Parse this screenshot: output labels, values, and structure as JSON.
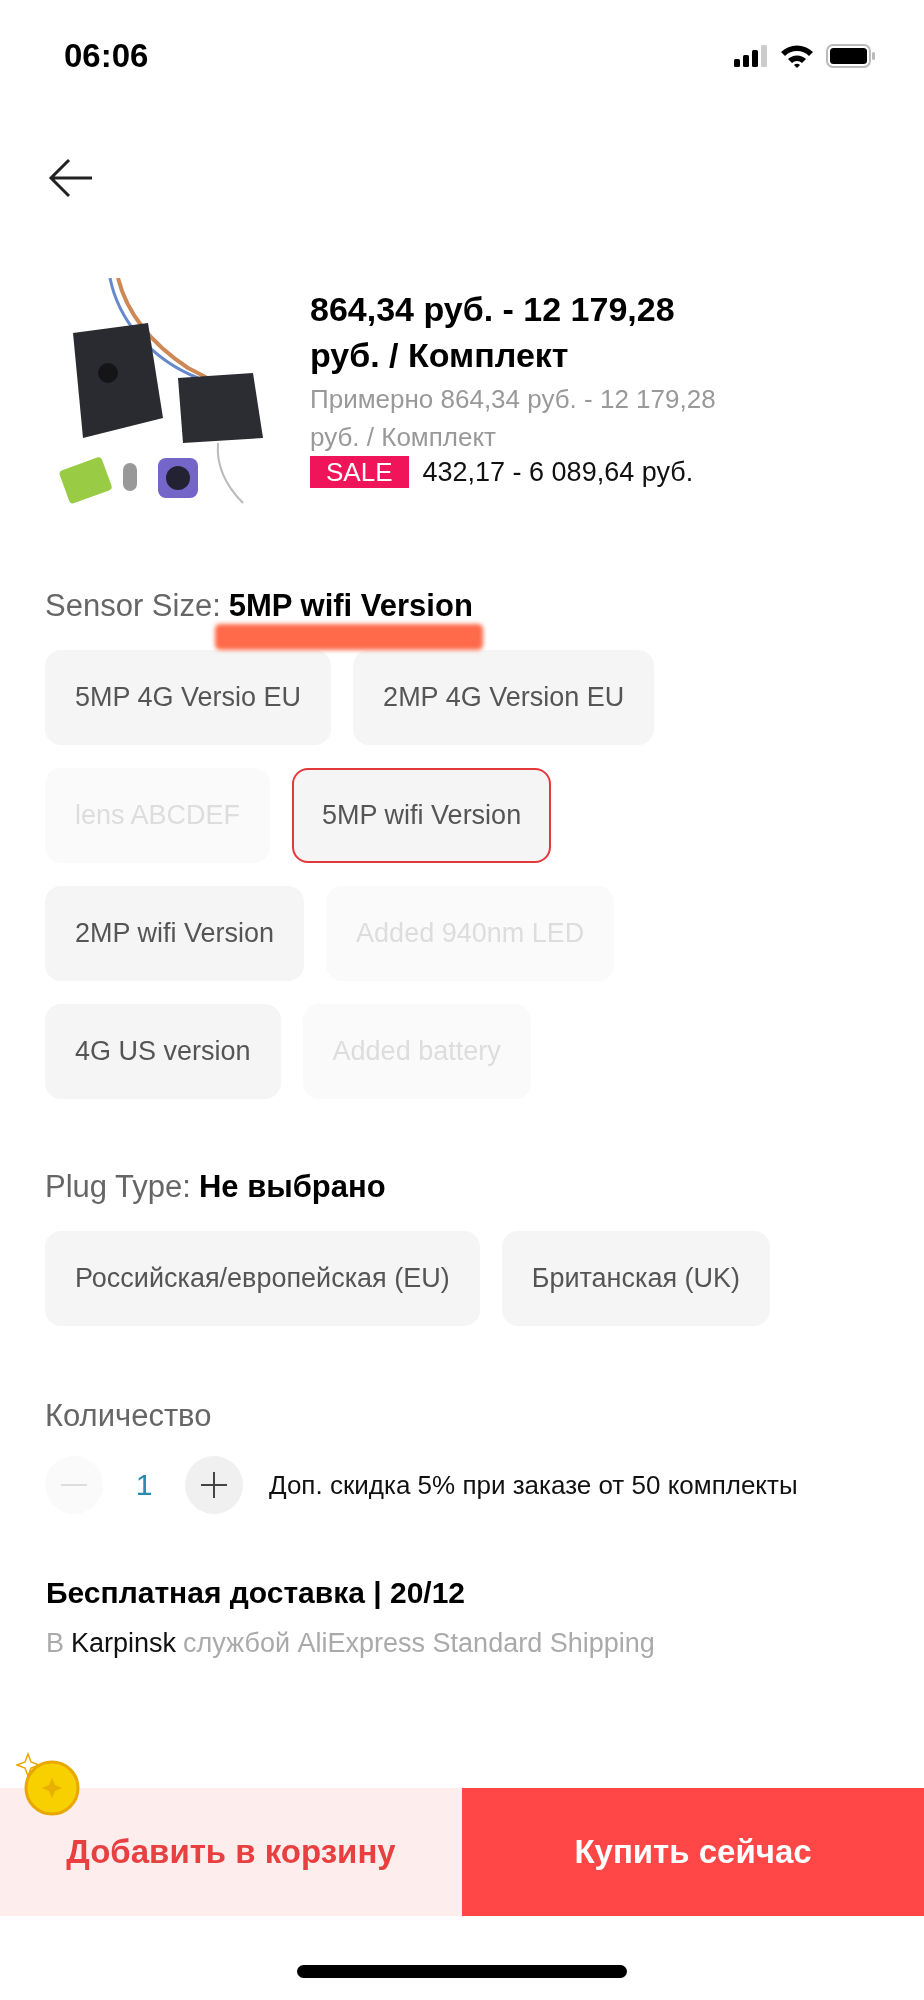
{
  "status_bar": {
    "time": "06:06"
  },
  "product": {
    "price": "864,34 руб. - 12 179,28 руб. / Комплект",
    "approx_price": "Примерно 864,34 руб. - 12 179,28 руб. / Комплект",
    "sale_badge": "SALE",
    "sale_price": "432,17 - 6 089,64 руб."
  },
  "sensor_size": {
    "label": "Sensor Size:",
    "value": "5MP wifi Version",
    "options": [
      {
        "label": "5MP 4G Versio EU",
        "selected": false,
        "disabled": false
      },
      {
        "label": "2MP 4G Version EU",
        "selected": false,
        "disabled": false
      },
      {
        "label": "lens ABCDEF",
        "selected": false,
        "disabled": true
      },
      {
        "label": "5MP wifi Version",
        "selected": true,
        "disabled": false
      },
      {
        "label": "2MP wifi Version",
        "selected": false,
        "disabled": false
      },
      {
        "label": "Added 940nm LED",
        "selected": false,
        "disabled": true
      },
      {
        "label": "4G US version",
        "selected": false,
        "disabled": false
      },
      {
        "label": "Added battery",
        "selected": false,
        "disabled": true
      }
    ]
  },
  "plug_type": {
    "label": "Plug Type:",
    "value": "Не выбрано",
    "options": [
      {
        "label": "Российская/европейская (EU)",
        "selected": false,
        "disabled": false
      },
      {
        "label": "Британская (UK)",
        "selected": false,
        "disabled": false
      }
    ]
  },
  "quantity": {
    "label": "Количество",
    "value": "1",
    "decrease_disabled": true,
    "discount_note": "Доп. скидка 5% при заказе от 50 комплекты"
  },
  "delivery": {
    "title": "Бесплатная доставка | 20/12",
    "prefix": "В",
    "city": "Karpinsk",
    "service": "службой AliExpress Standard Shipping"
  },
  "actions": {
    "add_to_cart": "Добавить в корзину",
    "buy_now": "Купить сейчас"
  }
}
